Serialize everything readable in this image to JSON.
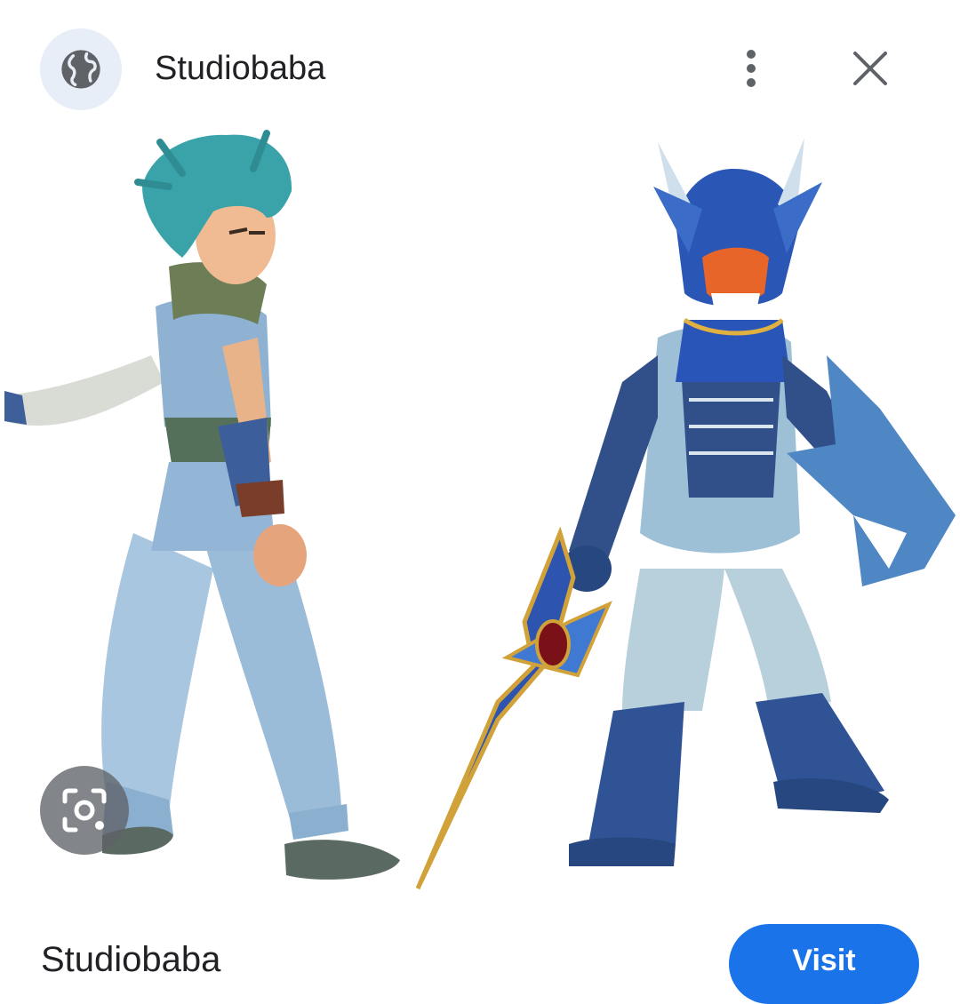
{
  "header": {
    "site_name": "Studiobaba",
    "globe_icon": "globe-icon",
    "more_icon": "more-vert-icon",
    "close_icon": "close-icon"
  },
  "image": {
    "description_left": "teal-haired boy in light blue outfit",
    "description_right": "blue dragon-armored warrior with sword"
  },
  "lens_icon": "lens-search-icon",
  "caption": "Studiobaba",
  "visit_button": {
    "label": "Visit"
  },
  "colors": {
    "accent": "#1a73e8",
    "icon_gray": "#5f6368",
    "icon_bg": "#e8eef8"
  }
}
